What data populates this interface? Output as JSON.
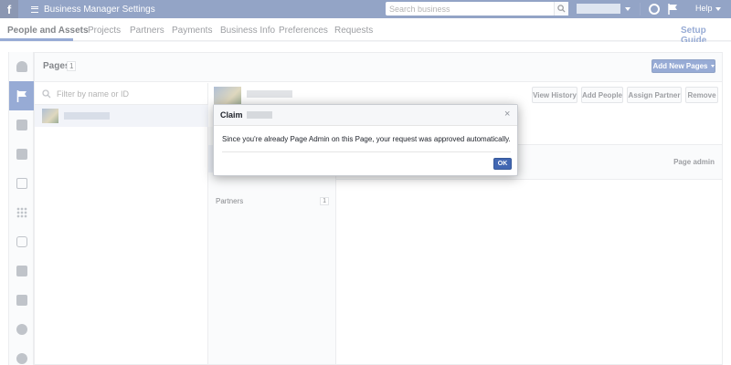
{
  "topbar": {
    "logo": "f",
    "app_title": "Business Manager Settings",
    "search_placeholder": "Search business",
    "help_label": "Help"
  },
  "nav": {
    "tabs": [
      {
        "label": "People and Assets",
        "active": true
      },
      {
        "label": "Projects"
      },
      {
        "label": "Partners"
      },
      {
        "label": "Payments"
      },
      {
        "label": "Business Info"
      },
      {
        "label": "Preferences"
      },
      {
        "label": "Requests"
      }
    ],
    "setup_guide": "Setup Guide"
  },
  "sidebar_icons": [
    "person-icon",
    "flag-icon",
    "ad-account-icon",
    "cube-icon",
    "calendar-icon",
    "apps-grid-icon",
    "instagram-icon",
    "briefcase-icon",
    "list-icon",
    "block-icon",
    "people-network-icon"
  ],
  "pages_panel": {
    "title": "Pages",
    "count": "1",
    "add_button": "Add New Pages",
    "filter_placeholder": "Filter by name or ID"
  },
  "detail": {
    "buttons": [
      "View History",
      "Add People",
      "Assign Partner",
      "Remove"
    ],
    "partners_label": "Partners",
    "partners_count": "1",
    "permission_label": "Page admin"
  },
  "dialog": {
    "title": "Claim",
    "close": "×",
    "message": "Since you're already Page Admin on this Page, your request was approved automatically.",
    "ok": "OK"
  },
  "colors": {
    "brand_blue": "#3b5998",
    "button_blue": "#4267b2"
  }
}
